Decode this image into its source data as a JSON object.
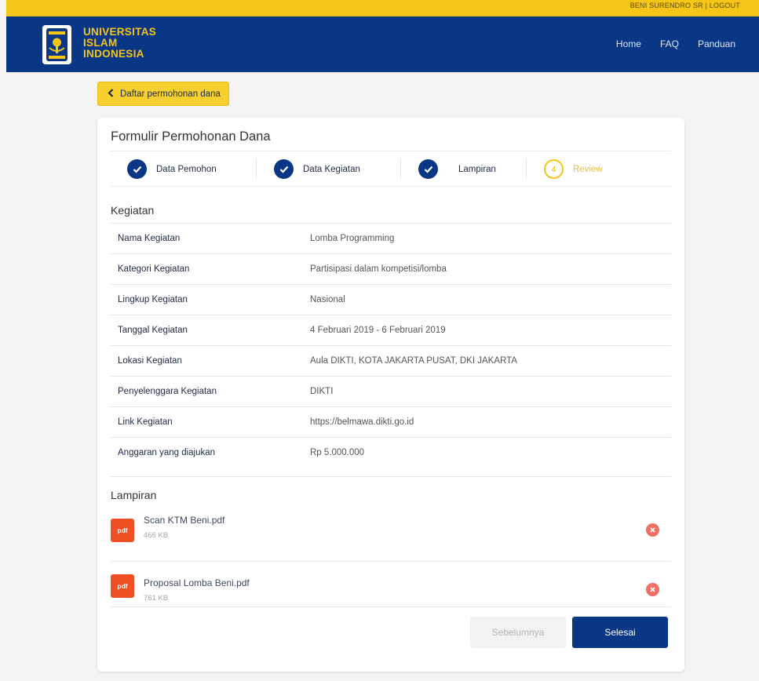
{
  "header": {
    "user_links": "BENI SURENDRO SR | LOGOUT",
    "logo_lines": [
      "UNIVERSITAS",
      "ISLAM",
      "INDONESIA"
    ],
    "nav": [
      "Home",
      "FAQ",
      "Panduan"
    ]
  },
  "back_button": {
    "label": "Daftar permohonan dana"
  },
  "form": {
    "title": "Formulir Permohonan Dana",
    "steps": [
      {
        "label": "Data Pemohon",
        "status": "done"
      },
      {
        "label": "Data Kegiatan",
        "status": "done"
      },
      {
        "label": "Lampiran",
        "status": "done"
      },
      {
        "label": "Review",
        "status": "current",
        "number": "4"
      }
    ],
    "kegiatan": {
      "title": "Kegiatan",
      "rows": [
        {
          "label": "Nama Kegiatan",
          "value": "Lomba Programming"
        },
        {
          "label": "Kategori Kegiatan",
          "value": "Partisipasi dalam kompetisi/lomba"
        },
        {
          "label": "Lingkup Kegiatan",
          "value": "Nasional"
        },
        {
          "label": "Tanggal Kegiatan",
          "value": "4 Februari 2019 - 6 Februari 2019"
        },
        {
          "label": "Lokasi Kegiatan",
          "value": "Aula DIKTI, KOTA JAKARTA PUSAT, DKI JAKARTA"
        },
        {
          "label": "Penyelenggara Kegiatan",
          "value": "DIKTI"
        },
        {
          "label": "Link Kegiatan",
          "value": "https://belmawa.dikti.go.id"
        },
        {
          "label": "Anggaran yang diajukan",
          "value": "Rp 5.000.000"
        }
      ]
    },
    "lampiran": {
      "title": "Lampiran",
      "files": [
        {
          "name": "Scan KTM Beni.pdf",
          "size": "466 KB",
          "badge": "pdf"
        },
        {
          "name": "Proposal Lomba Beni.pdf",
          "size": "761 KB",
          "badge": "pdf"
        }
      ]
    },
    "buttons": {
      "prev": "Sebelumnya",
      "done": "Selesai"
    }
  },
  "colors": {
    "brand_navy": "#0a3785",
    "brand_yellow": "#f5c518",
    "pdf_red": "#f04e23",
    "remove_red": "#ef6e66"
  }
}
